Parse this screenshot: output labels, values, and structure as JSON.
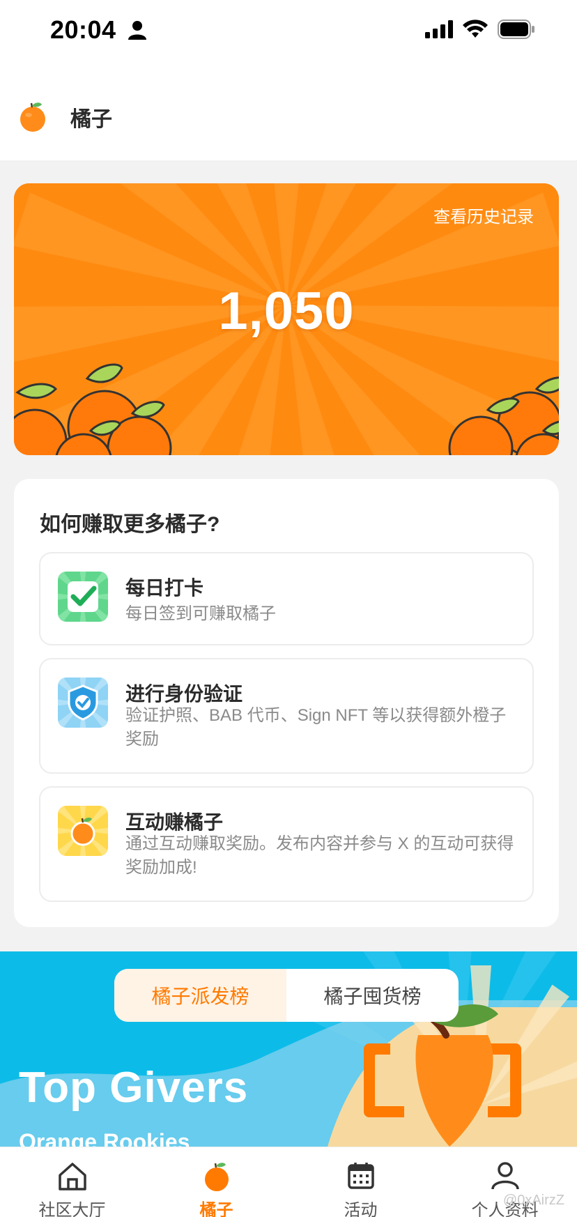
{
  "status_bar": {
    "time": "20:04"
  },
  "header": {
    "title": "橘子"
  },
  "points_card": {
    "history_link": "查看历史记录",
    "value": "1,050"
  },
  "earn": {
    "title": "如何赚取更多橘子?",
    "tasks": [
      {
        "title": "每日打卡",
        "desc": "每日签到可赚取橘子",
        "icon": "checkmark-icon"
      },
      {
        "title": "进行身份验证",
        "desc": "验证护照、BAB 代币、Sign NFT 等以获得额外橙子奖励",
        "icon": "shield-check-icon"
      },
      {
        "title": "互动赚橘子",
        "desc": "通过互动赚取奖励。发布内容并参与 X 的互动可获得奖励加成!",
        "icon": "orange-icon"
      }
    ]
  },
  "leaderboard": {
    "tabs": [
      {
        "label": "橘子派发榜",
        "active": true
      },
      {
        "label": "橘子囤货榜",
        "active": false
      }
    ],
    "title": "Top Givers",
    "subtitle": "Orange Rookies"
  },
  "bottom_nav": [
    {
      "label": "社区大厅",
      "icon": "home-icon",
      "active": false
    },
    {
      "label": "橘子",
      "icon": "orange-icon",
      "active": true
    },
    {
      "label": "活动",
      "icon": "calendar-icon",
      "active": false
    },
    {
      "label": "个人资料",
      "icon": "person-icon",
      "active": false
    }
  ],
  "watermark": "@0xAirzZ",
  "colors": {
    "accent": "#ff7a00",
    "card_orange": "#ff8a10",
    "leaderboard_blue": "#0dbbe8"
  }
}
